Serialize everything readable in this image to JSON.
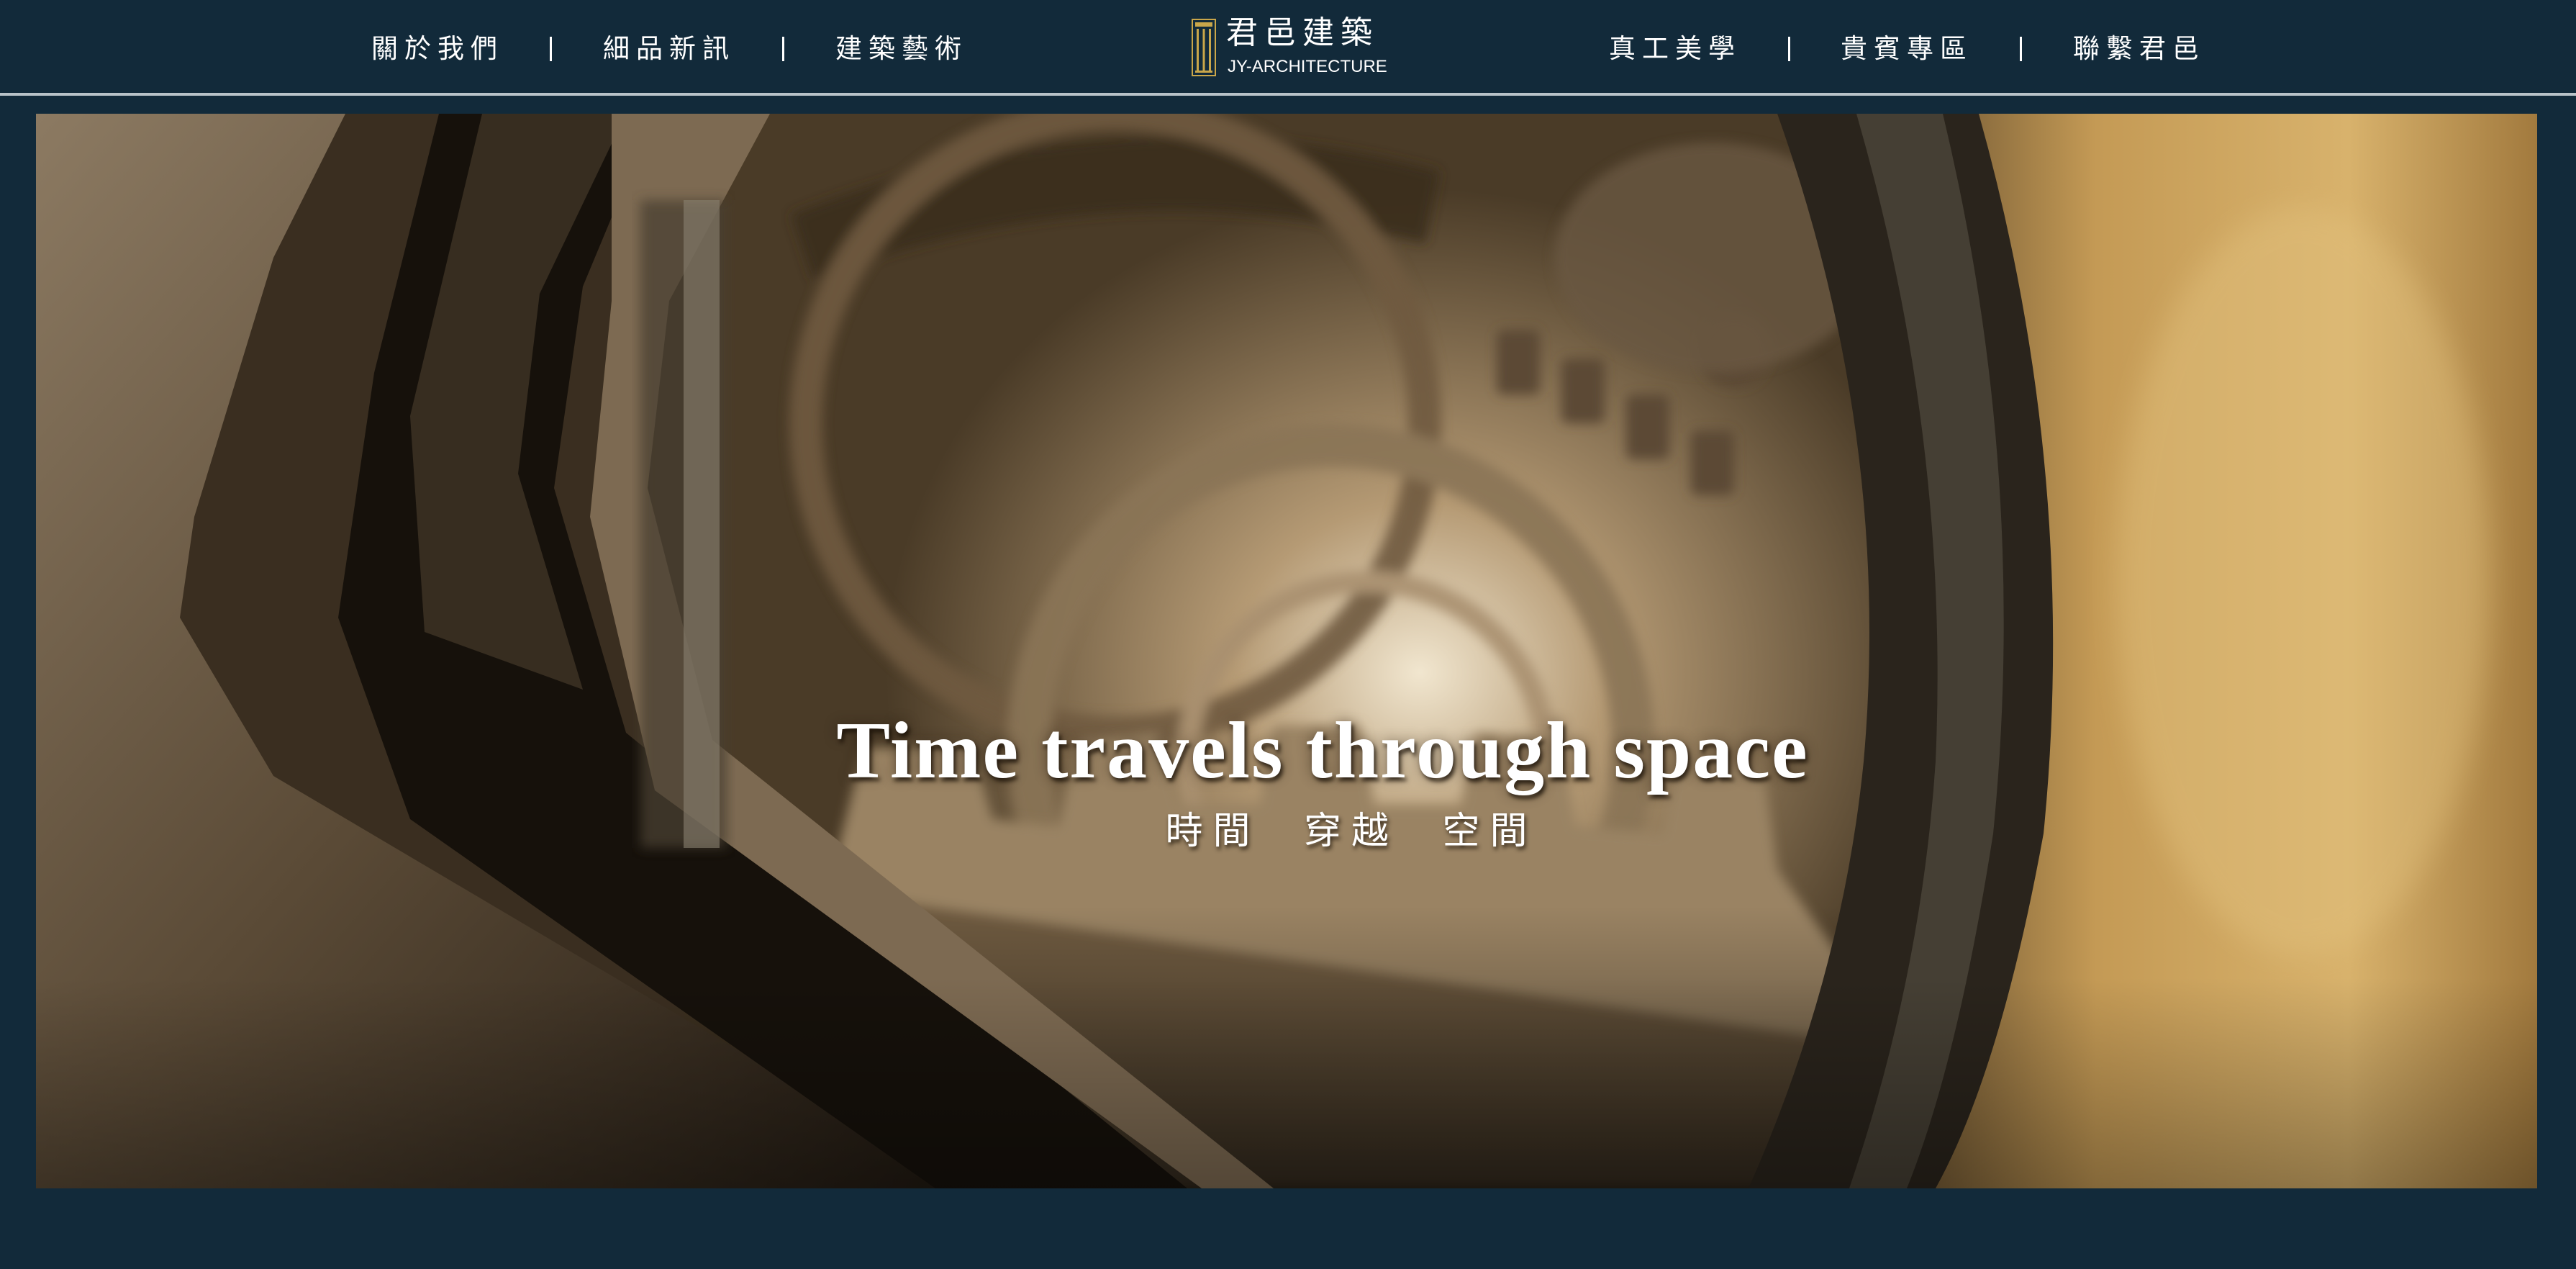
{
  "nav": {
    "left_items": [
      "關於我們",
      "細品新訊",
      "建築藝術"
    ],
    "right_items": [
      "真工美學",
      "貴賓專區",
      "聯繫君邑"
    ]
  },
  "logo": {
    "name_cn": "君邑建築",
    "name_en": "JY-ARCHITECTURE",
    "icon": "building-column-icon"
  },
  "hero": {
    "title": "Time travels through space",
    "subtitle": "時間 穿越 空間",
    "image": "clockwork-gears-icon"
  },
  "colors": {
    "background": "#122a3a",
    "logo_gold": "#c9a64a",
    "text": "#ffffff"
  }
}
